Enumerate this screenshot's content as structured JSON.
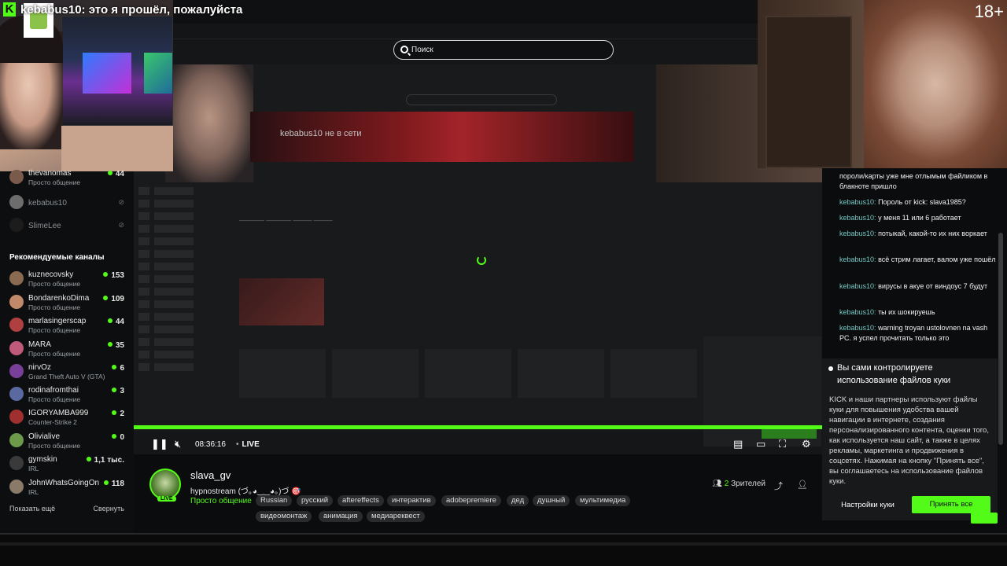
{
  "overlay": {
    "message": "kebabus10: это я прошёл, пожалуйста",
    "age_badge": "18+"
  },
  "player": {
    "search_placeholder": "Поиск",
    "time": "08:36:16",
    "live": "LIVE",
    "progress_fraction": 1.0,
    "embedded_banner_text": "kebabus10 не в сети"
  },
  "sidebar": {
    "following": [
      {
        "name": "thevanomas",
        "category": "Просто общение",
        "viewers": "44"
      },
      {
        "name": "kebabus10",
        "offline": true
      },
      {
        "name": "SlimeLee",
        "offline": true
      }
    ],
    "recommended_title": "Рекомендуемые каналы",
    "recommended": [
      {
        "name": "kuznecovsky",
        "category": "Просто общение",
        "viewers": "153"
      },
      {
        "name": "BondarenkoDima",
        "category": "Просто общение",
        "viewers": "109"
      },
      {
        "name": "marlasingerscap",
        "category": "Просто общение",
        "viewers": "44"
      },
      {
        "name": "MARA",
        "category": "Просто общение",
        "viewers": "35"
      },
      {
        "name": "nirvOz",
        "category": "Grand Theft Auto V (GTA)",
        "viewers": "6"
      },
      {
        "name": "rodinafromthai",
        "category": "Просто общение",
        "viewers": "3"
      },
      {
        "name": "IGORYAMBA999",
        "category": "Counter-Strike 2",
        "viewers": "2"
      },
      {
        "name": "Olivialive",
        "category": "Просто общение",
        "viewers": "0"
      },
      {
        "name": "gymskin",
        "category": "IRL",
        "viewers": "1,1 тыс."
      },
      {
        "name": "JohnWhatsGoingOn",
        "category": "IRL",
        "viewers": "118"
      }
    ],
    "show_more": "Показать ещё",
    "collapse": "Свернуть"
  },
  "stream": {
    "username": "slava_gv",
    "title": "hypnostream (づ｡◕‿‿◕｡)づ 🎯",
    "category": "Просто общение",
    "live_label": "LIVE",
    "viewers_count": "2",
    "viewers_label": "Зрителей",
    "tags": [
      "Russian",
      "русский",
      "aftereffects",
      "интерактив",
      "adobepremiere",
      "дед",
      "душный",
      "мультимедиа",
      "видеомонтаж",
      "анимация",
      "медиареквест"
    ]
  },
  "chat": {
    "messages": [
      {
        "user": "",
        "text": "пороли/карты уже мне отлымым файликом в блакноте пришло"
      },
      {
        "user": "kebabus10:",
        "text": "Пороль от kick: slava1985?"
      },
      {
        "user": "kebabus10:",
        "text": "у меня 11 или 6 работает"
      },
      {
        "user": "kebabus10:",
        "text": "потыкай, какой-то их них воркает"
      },
      {
        "user": "kebabus10:",
        "text": "всё стрим лагает, валом уже пошёл"
      },
      {
        "user": "kebabus10:",
        "text": "вирусы в акуе от виндоус 7 будут"
      },
      {
        "user": "kebabus10:",
        "text": "ты их шокируешь"
      },
      {
        "user": "kebabus10:",
        "text": "warning troyan ustolovnen na vash PC. я успел прочитать только это"
      }
    ]
  },
  "cookie": {
    "title": "Вы сами контролируете использование файлов куки",
    "body": "KICK и наши партнеры используют файлы куки для повышения удобства вашей навигации в интернете, создания персонализированного контента, оценки того, как используется наш сайт, а также в целях рекламы, маркетинга и продвижения в соцсетях. Нажимая на кнопку \"Принять все\", вы соглашаетесь на использование файлов куки.",
    "settings_label": "Настройки куки",
    "accept_label": "Принять все"
  },
  "colors": {
    "accent": "#53fc18",
    "chat_user": "#74c7c4"
  }
}
